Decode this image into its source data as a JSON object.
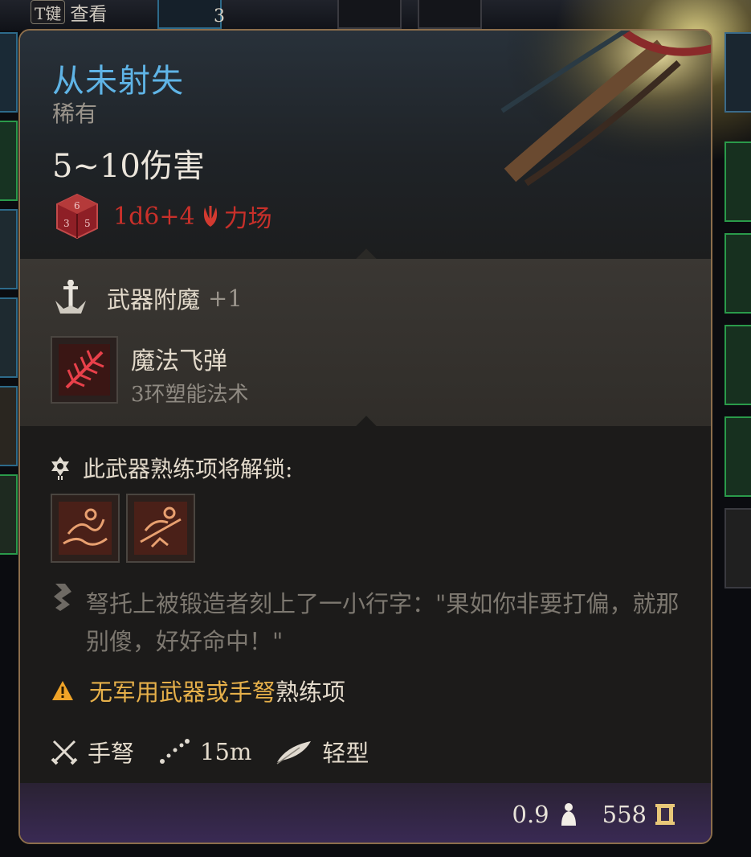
{
  "hud": {
    "hotkey": "T键",
    "hotkey_action": "查看",
    "stack_count": "3"
  },
  "item": {
    "name": "从未射失",
    "rarity": "稀有",
    "damage": "5~10伤害",
    "dice_formula": "1d6+4",
    "damage_type": "力场"
  },
  "enchant": {
    "label": "武器附魔",
    "bonus": "+1",
    "spell_name": "魔法飞弹",
    "spell_level": "3环塑能法术"
  },
  "proficiency": {
    "label": "此武器熟练项将解锁:"
  },
  "flavor": {
    "text": "弩托上被锻造者刻上了一小行字：\"果如你非要打偏，就那别傻，好好命中！\""
  },
  "warning": {
    "part1": "无军用武器或手弩",
    "part2": "熟练项"
  },
  "stats": {
    "weapon_type": "手弩",
    "range": "15m",
    "weight_class": "轻型"
  },
  "footer": {
    "weight": "0.9",
    "value": "558"
  },
  "colors": {
    "title": "#5fb4e6",
    "damage_red": "#c8302a",
    "warning": "#e6b04a",
    "border": "#8c6e4c"
  }
}
